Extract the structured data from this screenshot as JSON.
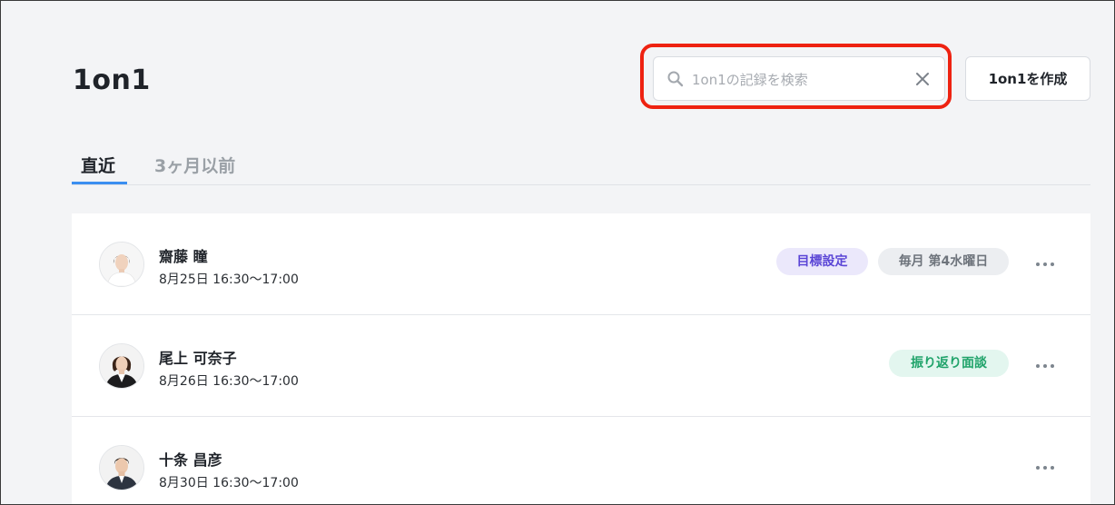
{
  "header": {
    "title": "1on1",
    "create_button_label": "1on1を作成"
  },
  "search": {
    "placeholder": "1on1の記録を検索",
    "value": ""
  },
  "tabs": [
    {
      "label": "直近",
      "active": true
    },
    {
      "label": "3ヶ月以前",
      "active": false
    }
  ],
  "meetings": [
    {
      "name": "齋藤 瞳",
      "datetime": "8月25日 16:30〜17:00",
      "tags": [
        "目標設定",
        "毎月 第4水曜日"
      ]
    },
    {
      "name": "尾上 可奈子",
      "datetime": "8月26日 16:30〜17:00",
      "tags": [
        "振り返り面談"
      ]
    },
    {
      "name": "十条 昌彦",
      "datetime": "8月30日 16:30〜17:00",
      "tags": []
    }
  ],
  "colors": {
    "accent": "#3b8ff0",
    "highlight": "#ee2211",
    "tag_goal": "#5a45d6",
    "tag_review": "#20a36a"
  },
  "icons": {
    "search": "search-icon",
    "clear": "close-icon",
    "more": "more-horizontal-icon"
  }
}
